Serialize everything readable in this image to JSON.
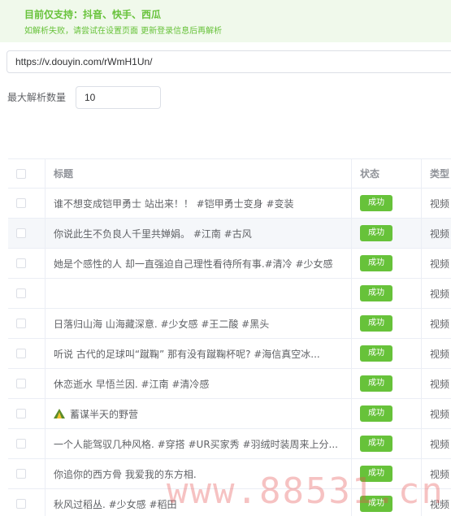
{
  "notice": {
    "title": "目前仅支持：抖音、快手、西瓜",
    "subtitle": "如解析失败，请尝试在设置页面 更新登录信息后再解析"
  },
  "url_input": {
    "value": "https://v.douyin.com/rWmH1Un/"
  },
  "count": {
    "label": "最大解析数量",
    "value": "10"
  },
  "table": {
    "headers": {
      "title": "标题",
      "status": "状态",
      "type": "类型"
    },
    "rows": [
      {
        "title": "谁不想变成铠甲勇士 站出来！！ #铠甲勇士变身 #变装",
        "status": "成功",
        "type": "视频"
      },
      {
        "title": "你说此生不负良人千里共婵娟。 #江南 #古风",
        "status": "成功",
        "type": "视频"
      },
      {
        "title": "她是个感性的人 却一直强迫自己理性看待所有事.#清冷 #少女感",
        "status": "成功",
        "type": "视频"
      },
      {
        "title": "",
        "status": "成功",
        "type": "视频"
      },
      {
        "title": "日落归山海 山海藏深意. #少女感 #王二酸 #黑头",
        "status": "成功",
        "type": "视频"
      },
      {
        "title": "听说 古代的足球叫“蹴鞠” 那有没有蹴鞠杯呢? #海信真空冰...",
        "status": "成功",
        "type": "视频"
      },
      {
        "title": "休恋逝水 早悟兰因. #江南 #清冷感",
        "status": "成功",
        "type": "视频"
      },
      {
        "title": "蓄谋半天的野营",
        "status": "成功",
        "type": "视频",
        "icon": "tent-icon"
      },
      {
        "title": "一个人能驾驭几种风格. #穿搭 #UR买家秀 #羽绒时装周来上分...",
        "status": "成功",
        "type": "视频"
      },
      {
        "title": "你追你的西方骨 我爱我的东方相.",
        "status": "成功",
        "type": "视频"
      },
      {
        "title": "秋风过稻丛. #少女感 #稻田",
        "status": "成功",
        "type": "视频"
      }
    ]
  },
  "watermark": "www.88531.cn",
  "colors": {
    "success": "#67c23a",
    "notice_bg": "#f0f9eb",
    "row_highlight": "#f5f7fa"
  }
}
